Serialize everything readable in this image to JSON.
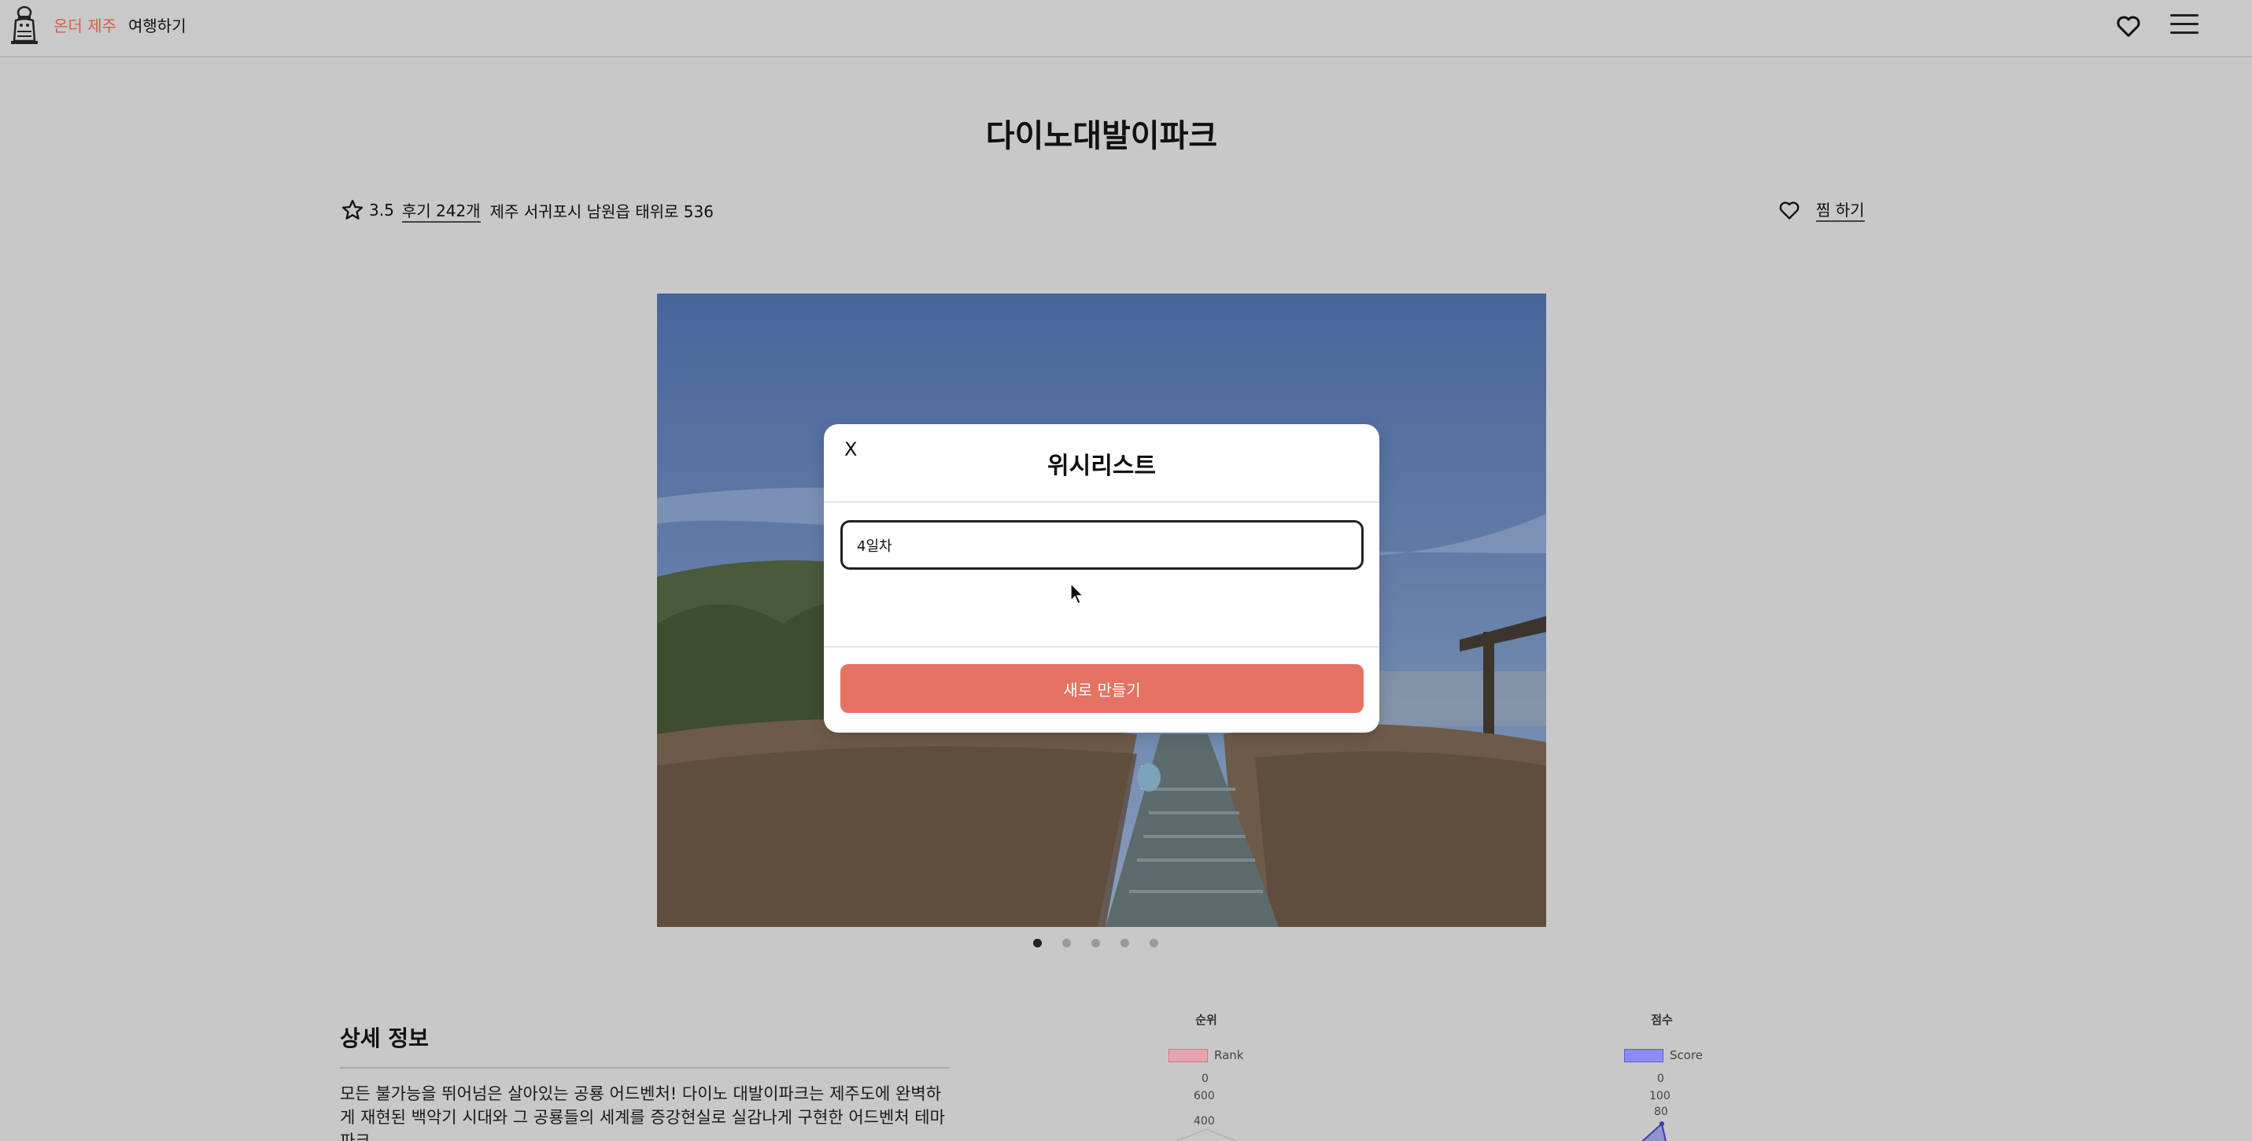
{
  "header": {
    "brand": "온더 제주",
    "nav_travel": "여행하기",
    "heart_icon": "heart-icon",
    "menu_icon": "hamburger-menu-icon"
  },
  "place": {
    "title": "다이노대발이파크",
    "rating": "3.5",
    "reviews": "후기 242개",
    "address": "제주 서귀포시 남원읍 태위로 536",
    "save_label": "찜 하기"
  },
  "carousel": {
    "total": 5,
    "active_index": 0
  },
  "modal": {
    "close_label": "X",
    "title": "위시리스트",
    "input_value": "4일차",
    "create_button": "새로 만들기"
  },
  "details": {
    "title": "상세 정보",
    "text": "모든 불가능을 뛰어넘은 살아있는 공룡 어드벤처! 다이노 대발이파크는 제주도에 완벽하게 재현된 백악기 시대와 그 공룡들의 세계를 증강현실로 실감나게 구현한 어드벤처 테마파크"
  },
  "charts": [
    {
      "title": "순위",
      "legend": "Rank",
      "color": "#e8a4ae",
      "ticks": [
        "0",
        "600",
        "400"
      ]
    },
    {
      "title": "점수",
      "legend": "Score",
      "color": "#8a8ef0",
      "ticks": [
        "0",
        "100",
        "80"
      ]
    }
  ],
  "colors": {
    "brand": "#d0604f",
    "primary_button": "#e57262",
    "overlay": "#c8c8c8"
  }
}
